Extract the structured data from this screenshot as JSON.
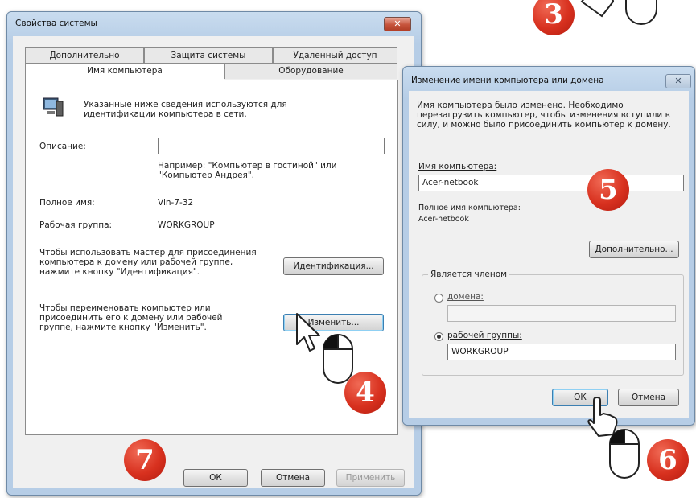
{
  "system_properties": {
    "title": "Свойства системы",
    "close_label": "✕",
    "tabs_top": [
      "Дополнительно",
      "Защита системы",
      "Удаленный доступ"
    ],
    "tabs_bottom": [
      "Имя компьютера",
      "Оборудование"
    ],
    "intro_text": "Указанные ниже сведения используются для идентификации компьютера в сети.",
    "description_label": "Описание:",
    "description_value": "",
    "example_text": "Например: \"Компьютер в гостиной\" или \"Компьютер Андрея\".",
    "full_name_label": "Полное имя:",
    "full_name_value": "Vin-7-32",
    "workgroup_label": "Рабочая группа:",
    "workgroup_value": "WORKGROUP",
    "id_text": "Чтобы использовать мастер для присоединения компьютера к домену или рабочей группе, нажмите кнопку \"Идентификация\".",
    "id_button": "Идентификация...",
    "rename_text": "Чтобы переименовать компьютер или присоединить его к домену или рабочей группе, нажмите кнопку \"Изменить\".",
    "rename_button": "Изменить...",
    "ok_button": "ОК",
    "cancel_button": "Отмена",
    "apply_button": "Применить"
  },
  "rename_dialog": {
    "title": "Изменение имени компьютера или домена",
    "close_label": "✕",
    "info_text": "Имя компьютера было изменено. Необходимо перезагрузить компьютер, чтобы изменения вступили в силу, и можно было присоединить компьютер к домену.",
    "computer_name_label": "Имя компьютера:",
    "computer_name_value": "Acer-netbook",
    "full_name_label": "Полное имя компьютера:",
    "full_name_value": "Acer-netbook",
    "more_button": "Дополнительно...",
    "member_of_label": "Является членом",
    "domain_label": "домена:",
    "domain_value": "",
    "workgroup_label": "рабочей группы:",
    "workgroup_value": "WORKGROUP",
    "ok_button": "ОК",
    "cancel_button": "Отмена"
  },
  "step_badges": [
    "3",
    "4",
    "5",
    "6",
    "7"
  ],
  "icons": [
    "computer-icon",
    "mouse-icon",
    "pointer-cursor-icon",
    "hand-cursor-icon",
    "close-icon"
  ],
  "colors": {
    "badge": "#d8311f",
    "window_frame": "#b6cde6",
    "client": "#f0f0f0"
  }
}
